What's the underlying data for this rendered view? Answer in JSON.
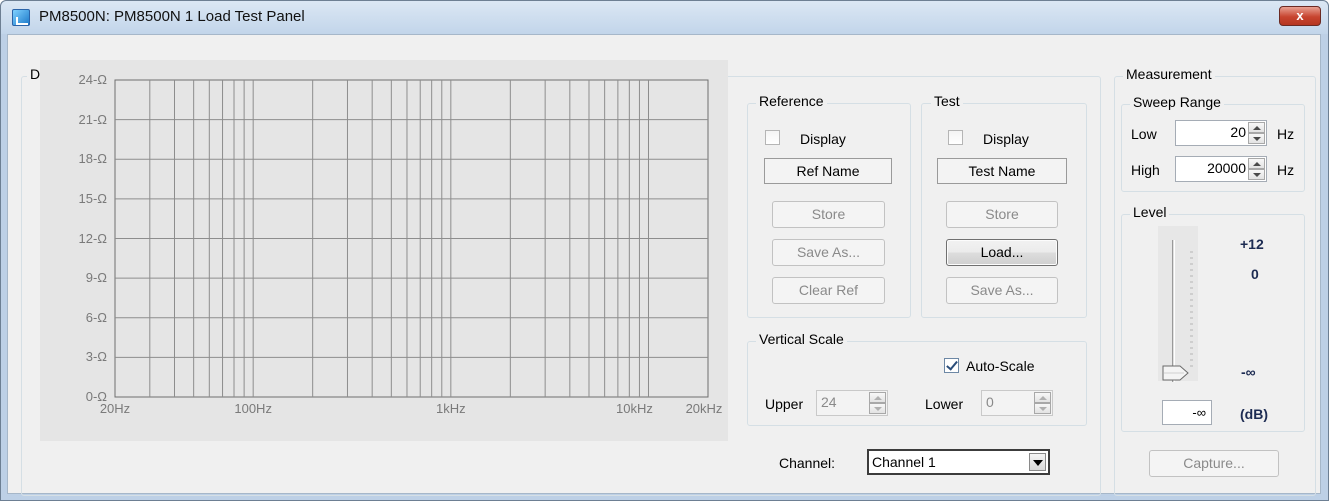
{
  "window": {
    "title": "PM8500N: PM8500N 1 Load Test Panel",
    "close_symbol": "x"
  },
  "display": {
    "group_label": "Display",
    "y_ticks": [
      "24-Ω",
      "21-Ω",
      "18-Ω",
      "15-Ω",
      "12-Ω",
      "9-Ω",
      "6-Ω",
      "3-Ω",
      "0-Ω"
    ],
    "x_ticks": [
      "20Hz",
      "100Hz",
      "1kHz",
      "10kHz",
      "20kHz"
    ]
  },
  "reference": {
    "group_label": "Reference",
    "display_label": "Display",
    "display_checked": false,
    "name": "Ref Name",
    "store_label": "Store",
    "save_as_label": "Save As...",
    "clear_label": "Clear Ref"
  },
  "test": {
    "group_label": "Test",
    "display_label": "Display",
    "display_checked": false,
    "name": "Test Name",
    "store_label": "Store",
    "load_label": "Load...",
    "save_as_label": "Save As..."
  },
  "vertical_scale": {
    "group_label": "Vertical Scale",
    "auto_scale_label": "Auto-Scale",
    "auto_scale_checked": true,
    "upper_label": "Upper",
    "upper_value": "24",
    "lower_label": "Lower",
    "lower_value": "0"
  },
  "channel": {
    "label": "Channel:",
    "selected": "Channel 1"
  },
  "measurement": {
    "group_label": "Measurement",
    "sweep_range": {
      "group_label": "Sweep Range",
      "low_label": "Low",
      "low_value": "20",
      "high_label": "High",
      "high_value": "20000",
      "unit": "Hz"
    },
    "level": {
      "group_label": "Level",
      "top_label": "+12",
      "zero_label": "0",
      "bottom_label": "-∞",
      "value": "-∞",
      "unit": "(dB)"
    },
    "capture_label": "Capture..."
  }
}
